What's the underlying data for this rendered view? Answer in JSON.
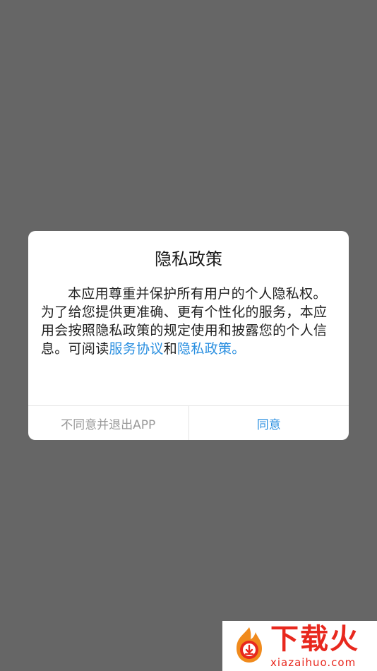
{
  "dialog": {
    "title": "隐私政策",
    "body_text_1": "本应用尊重并保护所有用户的个人隐私权。为了给您提供更准确、更有个性化的服务，本应用会按照隐私政策的规定使用和披露您的个人信息。可阅读",
    "link_service_agreement": "服务协议",
    "conjunction": "和",
    "link_privacy_policy": "隐私政策。",
    "decline_button": "不同意并退出APP",
    "agree_button": "同意"
  },
  "watermark": {
    "title": "下载火",
    "url": "xiazaihuo.com"
  },
  "colors": {
    "backdrop": "#666666",
    "link": "#2a8fe0",
    "watermark": "#e8281e"
  }
}
